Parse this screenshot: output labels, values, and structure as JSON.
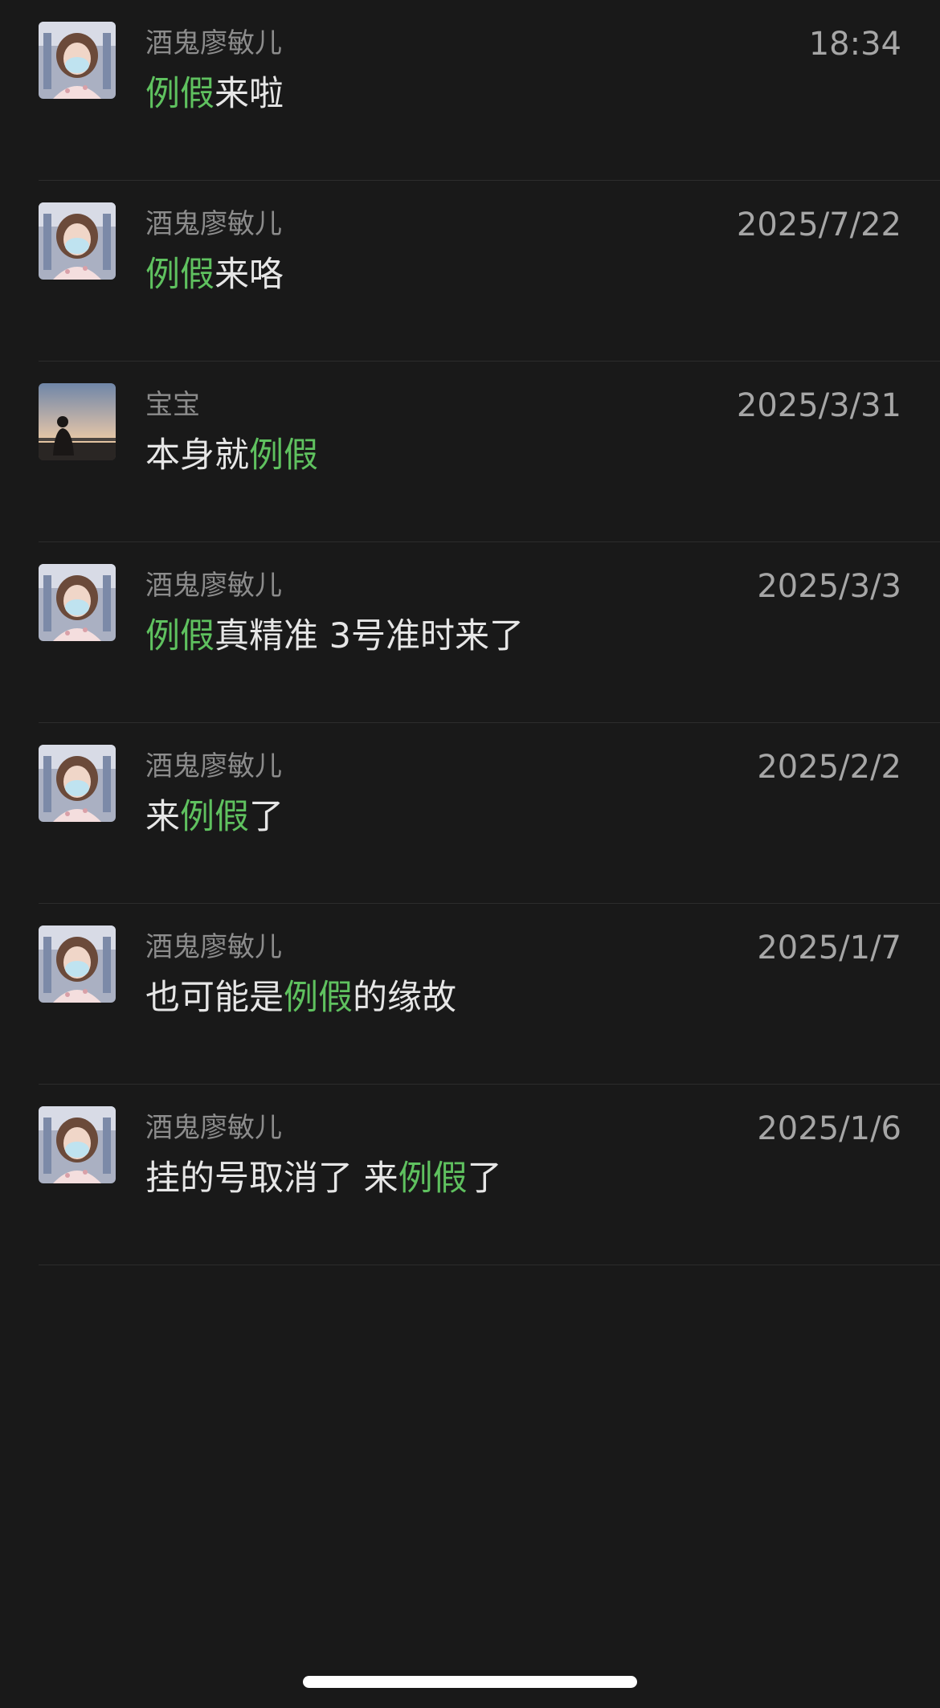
{
  "colors": {
    "background": "#191919",
    "highlight": "#5fc15f",
    "message_text": "#e6e6e6",
    "sender_text": "#8c8c8c",
    "time_text": "#a6a6a6",
    "divider": "#2c2c2c"
  },
  "results": [
    {
      "sender": "酒鬼廖敏儿",
      "time": "18:34",
      "avatar": "girl-avatar",
      "message": {
        "before": "",
        "highlight": "例假",
        "after": "来啦"
      }
    },
    {
      "sender": "酒鬼廖敏儿",
      "time": "2025/7/22",
      "avatar": "girl-avatar",
      "message": {
        "before": "",
        "highlight": "例假",
        "after": "来咯"
      }
    },
    {
      "sender": "宝宝",
      "time": "2025/3/31",
      "avatar": "sunset-silhouette-avatar",
      "message": {
        "before": "本身就",
        "highlight": "例假",
        "after": ""
      }
    },
    {
      "sender": "酒鬼廖敏儿",
      "time": "2025/3/3",
      "avatar": "girl-avatar",
      "message": {
        "before": "",
        "highlight": "例假",
        "after": "真精准 3号准时来了"
      }
    },
    {
      "sender": "酒鬼廖敏儿",
      "time": "2025/2/2",
      "avatar": "girl-avatar",
      "message": {
        "before": "来",
        "highlight": "例假",
        "after": "了"
      }
    },
    {
      "sender": "酒鬼廖敏儿",
      "time": "2025/1/7",
      "avatar": "girl-avatar",
      "message": {
        "before": "也可能是",
        "highlight": "例假",
        "after": "的缘故"
      }
    },
    {
      "sender": "酒鬼廖敏儿",
      "time": "2025/1/6",
      "avatar": "girl-avatar",
      "message": {
        "before": "挂的号取消了 来",
        "highlight": "例假",
        "after": "了"
      }
    }
  ]
}
